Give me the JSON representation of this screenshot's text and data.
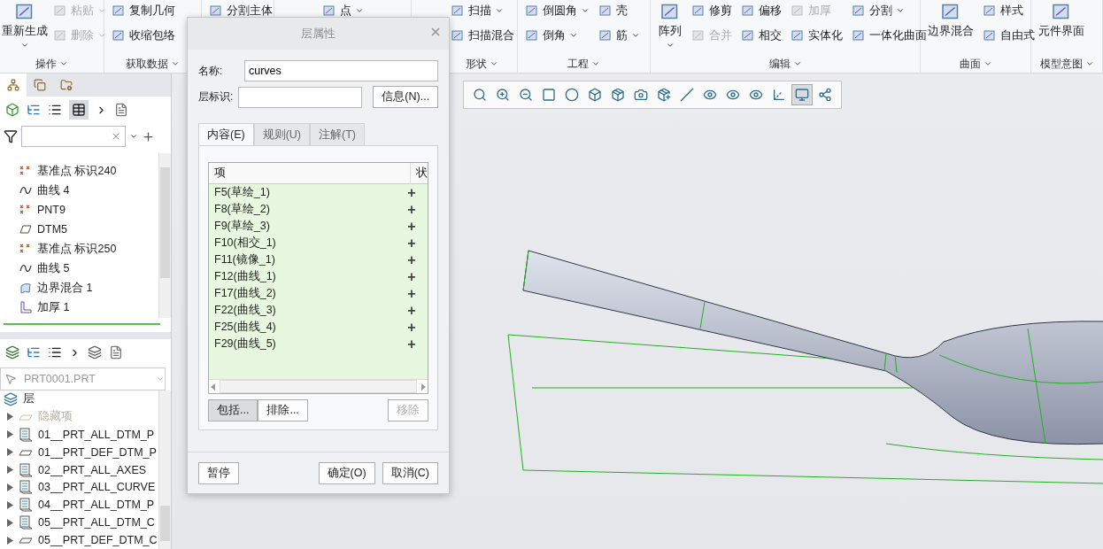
{
  "ribbon": {
    "groups": [
      {
        "label": "操作",
        "columns": [
          {
            "kind": "large",
            "items": [
              {
                "label": "重新生成",
                "disabled": false,
                "dropdown": true
              }
            ]
          },
          {
            "kind": "small",
            "items": [
              {
                "label": "粘贴",
                "disabled": true,
                "dropdown": true
              },
              {
                "label": "删除",
                "disabled": true,
                "dropdown": true
              }
            ]
          }
        ]
      },
      {
        "label": "获取数据",
        "columns": [
          {
            "kind": "small",
            "items": [
              {
                "label": "复制几何",
                "disabled": false,
                "dropdown": false
              },
              {
                "label": "收缩包络",
                "disabled": false,
                "dropdown": false
              }
            ]
          }
        ]
      },
      {
        "columns": [
          {
            "kind": "small",
            "items": [
              {
                "label": "分割主体",
                "disabled": false,
                "dropdown": false
              }
            ]
          }
        ]
      },
      {
        "columns": [
          {
            "kind": "small",
            "items": [
              {
                "label": "点",
                "disabled": false,
                "dropdown": true
              }
            ]
          }
        ]
      },
      {
        "label": "形状",
        "columns": [
          {
            "kind": "small",
            "items": [
              {
                "label": "扫描",
                "disabled": false,
                "dropdown": true
              },
              {
                "label": "扫描混合",
                "disabled": false,
                "dropdown": false
              }
            ]
          }
        ]
      },
      {
        "label": "工程",
        "columns": [
          {
            "kind": "small",
            "items": [
              {
                "label": "倒圆角",
                "disabled": false,
                "dropdown": true
              },
              {
                "label": "倒角",
                "disabled": false,
                "dropdown": true
              }
            ]
          },
          {
            "kind": "small",
            "items": [
              {
                "label": "壳",
                "disabled": false,
                "dropdown": false
              },
              {
                "label": "筋",
                "disabled": false,
                "dropdown": true
              }
            ]
          }
        ]
      },
      {
        "label": "编辑",
        "columns": [
          {
            "kind": "large",
            "items": [
              {
                "label": "阵列",
                "disabled": false,
                "dropdown": true
              }
            ]
          },
          {
            "kind": "small",
            "items": [
              {
                "label": "修剪",
                "disabled": false,
                "dropdown": false
              },
              {
                "label": "合并",
                "disabled": true,
                "dropdown": false
              }
            ]
          },
          {
            "kind": "small",
            "items": [
              {
                "label": "偏移",
                "disabled": false,
                "dropdown": false
              },
              {
                "label": "相交",
                "disabled": false,
                "dropdown": false
              }
            ]
          },
          {
            "kind": "small",
            "items": [
              {
                "label": "加厚",
                "disabled": true,
                "dropdown": false
              },
              {
                "label": "实体化",
                "disabled": false,
                "dropdown": false
              }
            ]
          },
          {
            "kind": "small",
            "items": [
              {
                "label": "分割",
                "disabled": false,
                "dropdown": true
              },
              {
                "label": "一体化曲面",
                "disabled": false,
                "dropdown": false
              }
            ]
          }
        ]
      },
      {
        "label": "曲面",
        "columns": [
          {
            "kind": "large",
            "items": [
              {
                "label": "边界混合",
                "disabled": false,
                "dropdown": false
              }
            ]
          },
          {
            "kind": "small",
            "items": [
              {
                "label": "样式",
                "disabled": false,
                "dropdown": false
              },
              {
                "label": "自由式",
                "disabled": false,
                "dropdown": false
              }
            ]
          }
        ]
      },
      {
        "label": "模型意图",
        "columns": [
          {
            "kind": "large",
            "items": [
              {
                "label": "元件界面",
                "disabled": false,
                "dropdown": false
              }
            ]
          }
        ]
      }
    ]
  },
  "panel_tabs": [
    {
      "selected": true
    },
    {
      "selected": false
    },
    {
      "selected": false
    }
  ],
  "model_tree": {
    "items": [
      {
        "kind": "point",
        "label": "基准点 标识240"
      },
      {
        "kind": "curve",
        "label": "曲线 4"
      },
      {
        "kind": "point",
        "label": "PNT9"
      },
      {
        "kind": "plane",
        "label": "DTM5"
      },
      {
        "kind": "point",
        "label": "基准点 标识250"
      },
      {
        "kind": "curve",
        "label": "曲线 5"
      },
      {
        "kind": "surface",
        "label": "边界混合 1"
      },
      {
        "kind": "thicken",
        "label": "加厚 1"
      }
    ]
  },
  "layer_tree": {
    "model": "PRT0001.PRT",
    "root": "层",
    "items": [
      {
        "kind": "plain",
        "label": "隐藏项",
        "disabled": true
      },
      {
        "kind": "rule",
        "label": "01__PRT_ALL_DTM_P",
        "disabled": false
      },
      {
        "kind": "plain",
        "label": "01__PRT_DEF_DTM_P",
        "disabled": false
      },
      {
        "kind": "rule",
        "label": "02__PRT_ALL_AXES",
        "disabled": false
      },
      {
        "kind": "rule",
        "label": "03__PRT_ALL_CURVE",
        "disabled": false
      },
      {
        "kind": "rule",
        "label": "04__PRT_ALL_DTM_P",
        "disabled": false
      },
      {
        "kind": "rule",
        "label": "05__PRT_ALL_DTM_C",
        "disabled": false
      },
      {
        "kind": "plain",
        "label": "05__PRT_DEF_DTM_C",
        "disabled": false
      }
    ]
  },
  "graphics_toolbar": [
    {
      "selected": false
    },
    {
      "selected": false
    },
    {
      "selected": false
    },
    {
      "selected": false
    },
    {
      "selected": false
    },
    {
      "selected": false
    },
    {
      "selected": false
    },
    {
      "selected": false
    },
    {
      "selected": false
    },
    {
      "selected": false
    },
    {
      "selected": false
    },
    {
      "selected": false
    },
    {
      "selected": false
    },
    {
      "selected": false
    },
    {
      "selected": true
    },
    {
      "selected": false
    }
  ],
  "dialog": {
    "title": "层属性",
    "name_label": "名称:",
    "name_value": "curves",
    "id_label": "层标识:",
    "info_button": "信息(N)...",
    "tabs": [
      {
        "label": "内容(E)",
        "selected": true
      },
      {
        "label": "规则(U)",
        "selected": false
      },
      {
        "label": "注解(T)",
        "selected": false
      }
    ],
    "table": {
      "columns": [
        "项",
        "状"
      ],
      "rows": [
        {
          "item": "F5(草绘_1)",
          "status": "+"
        },
        {
          "item": "F8(草绘_2)",
          "status": "+"
        },
        {
          "item": "F9(草绘_3)",
          "status": "+"
        },
        {
          "item": "F10(相交_1)",
          "status": "+"
        },
        {
          "item": "F11(镜像_1)",
          "status": "+"
        },
        {
          "item": "F12(曲线_1)",
          "status": "+"
        },
        {
          "item": "F17(曲线_2)",
          "status": "+"
        },
        {
          "item": "F22(曲线_3)",
          "status": "+"
        },
        {
          "item": "F25(曲线_4)",
          "status": "+"
        },
        {
          "item": "F29(曲线_5)",
          "status": "+"
        }
      ]
    },
    "actions": [
      {
        "label": "包括...",
        "selected": true,
        "disabled": false
      },
      {
        "label": "排除...",
        "selected": false,
        "disabled": false
      },
      {
        "label": "移除",
        "selected": false,
        "disabled": true
      }
    ],
    "footer": {
      "pause": "暂停",
      "ok": "确定(O)",
      "cancel": "取消(C)"
    }
  }
}
